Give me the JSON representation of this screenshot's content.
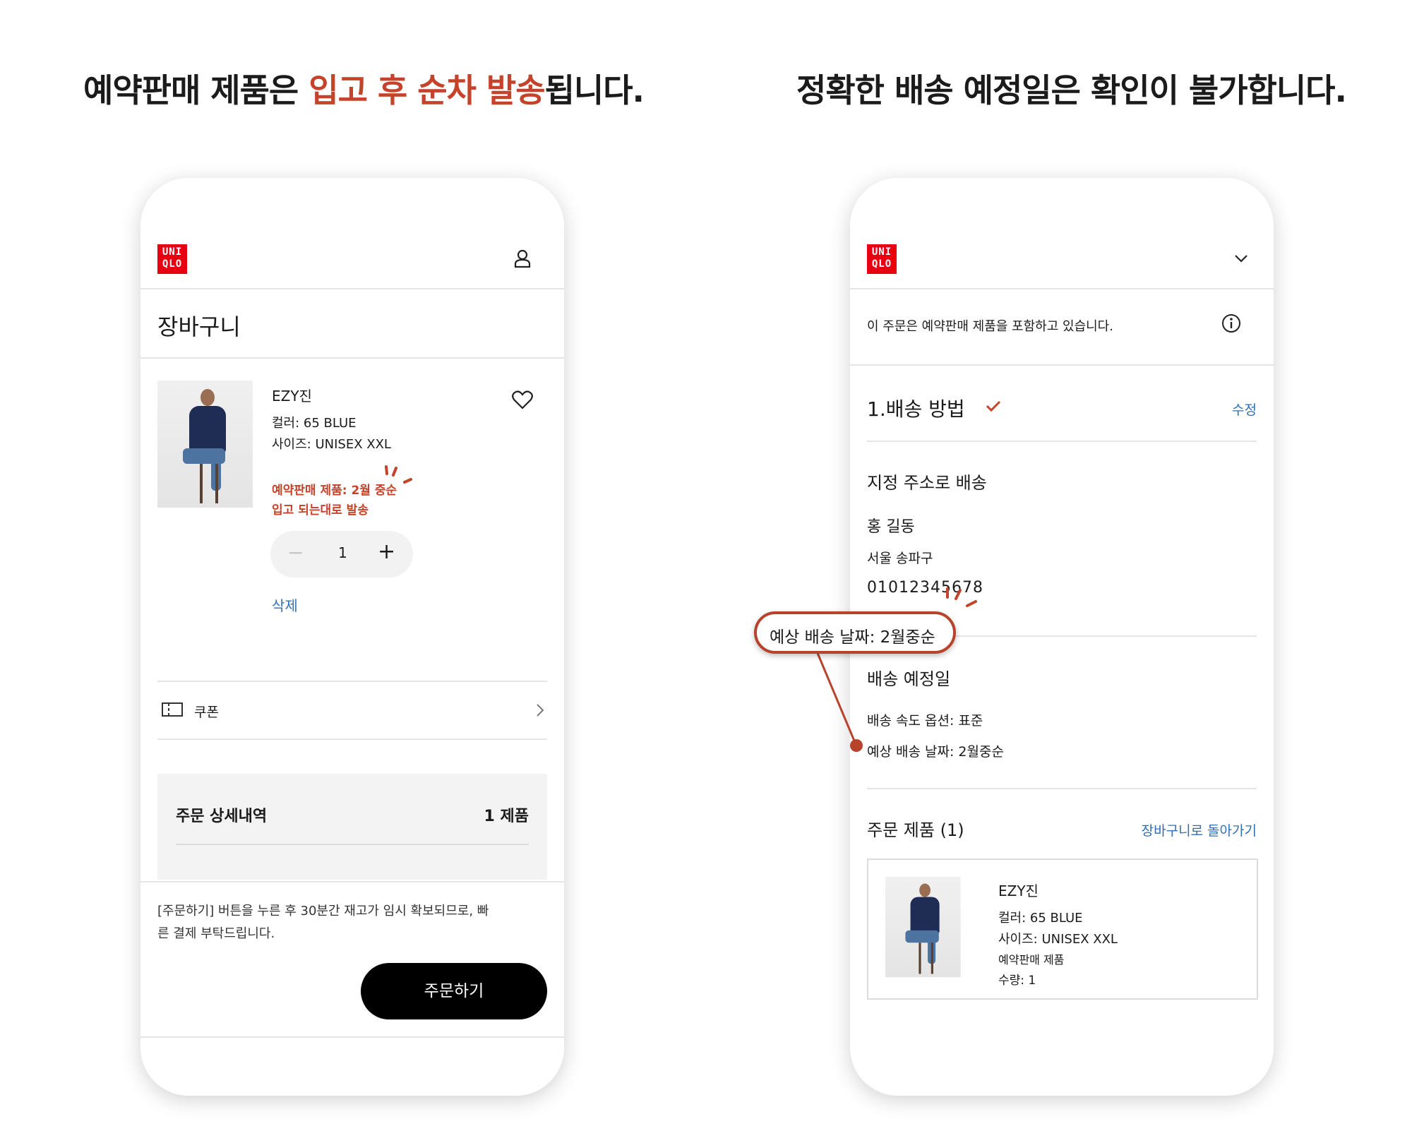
{
  "headline_left": {
    "part1": "예약판매 제품은 ",
    "accent": "입고 후 순차 발송",
    "part2": "됩니다."
  },
  "headline_right": "정확한 배송 예정일은 확인이 불가합니다.",
  "colors": {
    "accent": "#c4432a",
    "link": "#2f6fb3",
    "brand": "#e60012"
  },
  "logo": {
    "line1": "UNI",
    "line2": "QLO"
  },
  "cart": {
    "title": "장바구니",
    "product": {
      "name": "EZY진",
      "color": "컬러: 65 BLUE",
      "size": "사이즈: UNISEX XXL",
      "preorder_line1": "예약판매 제품: 2월 중순",
      "preorder_line2": "입고 되는대로 발송",
      "quantity": "1",
      "minus": "−",
      "plus": "+",
      "delete": "삭제"
    },
    "coupon": "쿠폰",
    "summary_title": "주문 상세내역",
    "summary_count": "1 제품",
    "notice": "[주문하기] 버튼을 누른 후 30분간 재고가 임시 확보되므로, 빠",
    "notice2": "른 결제 부탁드립니다.",
    "order_button": "주문하기"
  },
  "checkout": {
    "preorder_notice": "이 주문은 예약판매 제품을 포함하고 있습니다.",
    "step_title": "1.배송 방법",
    "edit": "수정",
    "method": "지정 주소로 배송",
    "recipient": "홍 길동",
    "address": "서울 송파구",
    "phone": "01012345678",
    "callout": "예상 배송 날짜: 2월중순",
    "schedule_title": "배송 예정일",
    "speed": "배송 속도 옵션: 표준",
    "expected": "예상 배송 날짜: 2월중순",
    "order_items_title": "주문 제품 (1)",
    "back_to_cart": "장바구니로 돌아가기",
    "item": {
      "name": "EZY진",
      "color": "컬러: 65 BLUE",
      "size": "사이즈: UNISEX XXL",
      "preorder": "예약판매 제품",
      "qty": "수량: 1"
    }
  }
}
